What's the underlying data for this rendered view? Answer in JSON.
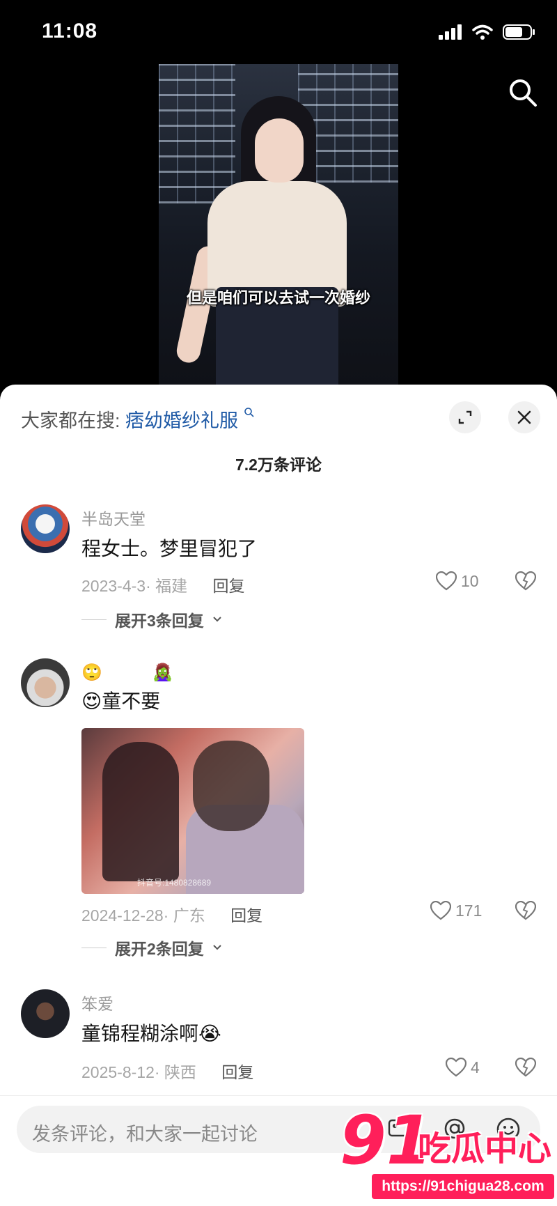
{
  "status_bar": {
    "time": "11:08"
  },
  "video": {
    "subtitle": "但是咱们可以去试一次婚纱"
  },
  "sheet": {
    "hot_search_prefix": "大家都在搜:",
    "hot_search_keyword": "痞幼婚纱礼服",
    "comment_count": "7.2万条评论"
  },
  "comments": [
    {
      "user": "半岛天堂",
      "text": "程女士。梦里冒犯了",
      "date_loc": "2023-4-3· 福建",
      "reply": "回复",
      "likes": "10",
      "expand": "展开3条回复"
    },
    {
      "user": "🙄　　　🧟‍♀️",
      "text": "😍童不要",
      "image_watermark": "抖音号:1480828689",
      "date_loc": "2024-12-28· 广东",
      "reply": "回复",
      "likes": "171",
      "expand": "展开2条回复"
    },
    {
      "user": "笨爱",
      "text": "童锦程糊涂啊😭",
      "date_loc": "2025-8-12· 陕西",
      "reply": "回复",
      "likes": "4"
    }
  ],
  "input_bar": {
    "placeholder": "发条评论，和大家一起讨论"
  },
  "watermark": {
    "logo": "91",
    "name": "吃瓜中心",
    "url": "https://91chigua28.com"
  }
}
